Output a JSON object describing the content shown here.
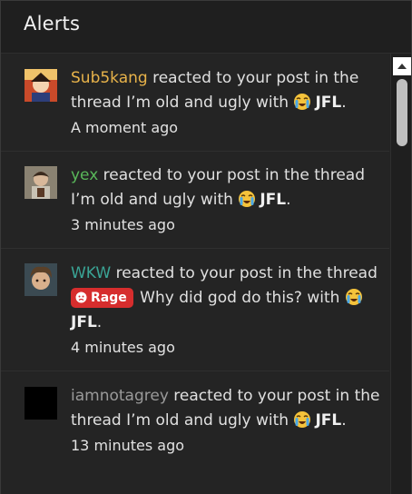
{
  "panel": {
    "title": "Alerts"
  },
  "alerts": [
    {
      "username": "Sub5kang",
      "action": " reacted to your post in the thread I’m old and ugly with ",
      "reaction": "JFL",
      "end": ".",
      "time": "A moment ago"
    },
    {
      "username": "yex",
      "action": " reacted to your post in the thread I’m old and ugly with ",
      "reaction": "JFL",
      "end": ".",
      "time": "3 minutes ago"
    },
    {
      "username": "WKW",
      "action_a": " reacted to your post in the thread ",
      "prefix": "Rage",
      "action_b": " Why did god do this? with ",
      "reaction": "JFL",
      "end": ".",
      "time": "4 minutes ago"
    },
    {
      "username": "iamnotagrey",
      "action": " reacted to your post in the thread I’m old and ugly with ",
      "reaction": "JFL",
      "end": ".",
      "time": "13 minutes ago"
    }
  ],
  "colors": {
    "sub5kang": "#e8b34a",
    "yex": "#59b85a",
    "wkw": "#3aa596",
    "iamnotagrey": "#9a9a9a",
    "rage_badge": "#d62d2d"
  },
  "icons": {
    "reaction": "loudly-crying-face-icon",
    "rage": "angry-face-icon",
    "scroll_up": "scroll-up-arrow-icon"
  }
}
